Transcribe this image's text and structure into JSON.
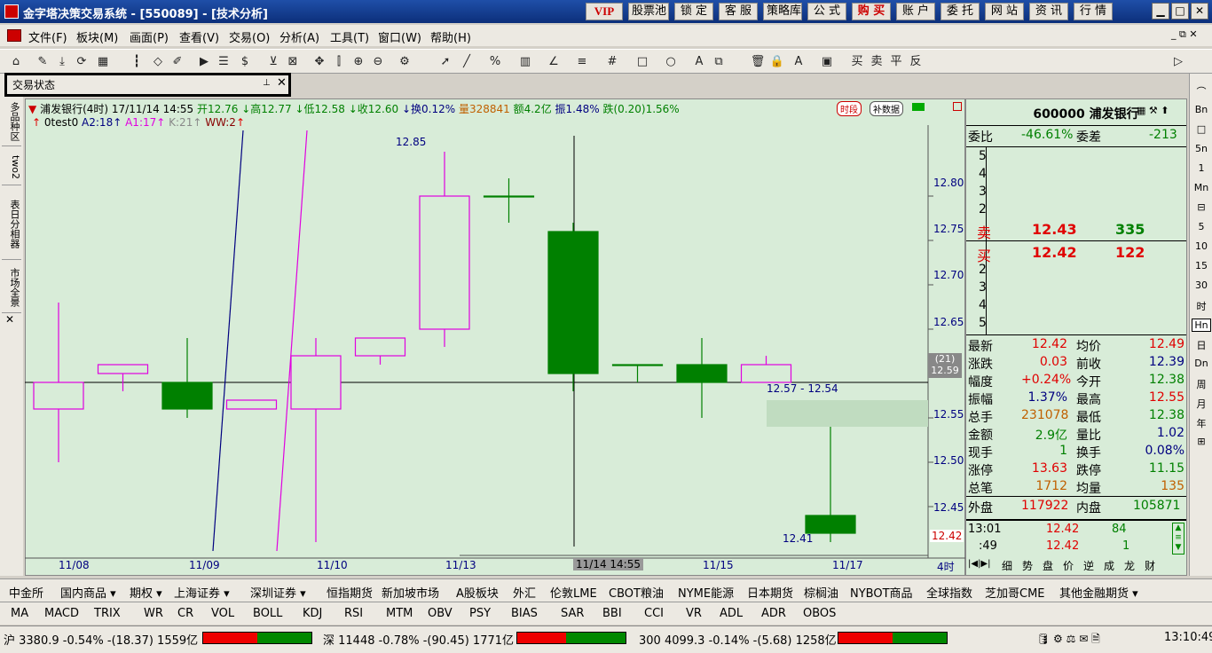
{
  "window": {
    "title": "金字塔决策交易系统 - [550089] - [技术分析]",
    "top_buttons": [
      "VIP",
      "股票池",
      "锁 定",
      "客 服",
      "策略库",
      "公 式",
      "购 买",
      "账 户",
      "委 托",
      "网 站",
      "资 讯",
      "行 情"
    ]
  },
  "menu": [
    "文件(F)",
    "板块(M)",
    "画面(P)",
    "查看(V)",
    "交易(O)",
    "分析(A)",
    "工具(T)",
    "窗口(W)",
    "帮助(H)"
  ],
  "trade_panel": {
    "title": "交易状态",
    "pin": "ᵖ",
    "close": "✕"
  },
  "left_tabs": [
    "多品种区",
    "two2",
    "表日分相器",
    "市场全景"
  ],
  "left_close": "✕",
  "chart": {
    "header": {
      "name": "浦发银行(4时)",
      "datetime": "17/11/14 14:55",
      "open": "开12.76",
      "high": "高12.77",
      "low": "低12.58",
      "close": "收12.60",
      "turnover": "换0.12%",
      "volume": "量328841",
      "amount": "额4.2亿",
      "amplitude": "振1.48%",
      "change": "跌(0.20)1.56%"
    },
    "indicator": {
      "name": "0test0",
      "a2": "A2:18",
      "a1": "A1:17",
      "k": "K:21",
      "ww": "WW:2"
    },
    "badges": [
      "时段",
      "补数据"
    ],
    "price_labels": [
      "12.80",
      "12.75",
      "12.70",
      "12.65",
      "12.55",
      "12.50",
      "12.45"
    ],
    "cursor_price": "(21)\n12.59",
    "cursor_price_a": "(21)",
    "cursor_price_b": "12.59",
    "low_label": "12.42",
    "annot_high": "12.85",
    "annot_low": "12.41",
    "annot_range": "12.57 - 12.54",
    "date_labels": [
      "11/08",
      "11/09",
      "11/10",
      "11/13",
      "11/14 14:55",
      "11/15",
      "11/17"
    ],
    "period": "4时"
  },
  "chart_data": {
    "type": "candlestick",
    "title": "浦发银行(4时)",
    "ylim": [
      12.4,
      12.86
    ],
    "candles": [
      {
        "o": 12.59,
        "h": 12.68,
        "l": 12.5,
        "c": 12.56,
        "color": "magenta"
      },
      {
        "o": 12.6,
        "h": 12.61,
        "l": 12.58,
        "c": 12.61,
        "color": "magenta"
      },
      {
        "o": 12.56,
        "h": 12.64,
        "l": 12.55,
        "c": 12.59,
        "color": "green"
      },
      {
        "o": 12.56,
        "h": 12.57,
        "l": 12.56,
        "c": 12.57,
        "color": "magenta"
      },
      {
        "o": 12.56,
        "h": 12.64,
        "l": 12.41,
        "c": 12.62,
        "color": "magenta"
      },
      {
        "o": 12.62,
        "h": 12.64,
        "l": 12.61,
        "c": 12.64,
        "color": "magenta"
      },
      {
        "o": 12.65,
        "h": 12.85,
        "l": 12.63,
        "c": 12.8,
        "color": "magenta"
      },
      {
        "o": 12.8,
        "h": 12.82,
        "l": 12.77,
        "c": 12.8,
        "color": "green"
      },
      {
        "o": 12.76,
        "h": 12.77,
        "l": 12.58,
        "c": 12.6,
        "color": "green"
      },
      {
        "o": 12.61,
        "h": 12.61,
        "l": 12.59,
        "c": 12.61,
        "color": "green"
      },
      {
        "o": 12.61,
        "h": 12.64,
        "l": 12.55,
        "c": 12.59,
        "color": "green"
      },
      {
        "o": 12.61,
        "h": 12.62,
        "l": 12.59,
        "c": 12.59,
        "color": "magenta"
      },
      {
        "o": 12.44,
        "h": 12.54,
        "l": 12.41,
        "c": 12.42,
        "color": "green"
      }
    ]
  },
  "quote": {
    "code": "600000",
    "name": "浦发银行",
    "weibi_label": "委比",
    "weibi": "-46.61%",
    "weicha_label": "委差",
    "weicha": "-213",
    "sell_levels": [
      "5",
      "4",
      "3",
      "2"
    ],
    "sell_label": "卖",
    "sell_price": "12.43",
    "sell_vol": "335",
    "buy_label": "买",
    "buy_price": "12.42",
    "buy_vol": "122",
    "buy_levels": [
      "2",
      "3",
      "4",
      "5"
    ],
    "stats": [
      {
        "l1": "最新",
        "v1": "12.42",
        "c1": "red",
        "l2": "均价",
        "v2": "12.49",
        "c2": "red"
      },
      {
        "l1": "涨跌",
        "v1": "0.03",
        "c1": "red",
        "l2": "前收",
        "v2": "12.39",
        "c2": "blue"
      },
      {
        "l1": "幅度",
        "v1": "+0.24%",
        "c1": "red",
        "l2": "今开",
        "v2": "12.38",
        "c2": "grn"
      },
      {
        "l1": "振幅",
        "v1": "1.37%",
        "c1": "blue",
        "l2": "最高",
        "v2": "12.55",
        "c2": "red"
      },
      {
        "l1": "总手",
        "v1": "231078",
        "c1": "orange",
        "l2": "最低",
        "v2": "12.38",
        "c2": "grn"
      },
      {
        "l1": "金额",
        "v1": "2.9亿",
        "c1": "grn",
        "l2": "量比",
        "v2": "1.02",
        "c2": "blue"
      },
      {
        "l1": "现手",
        "v1": "1",
        "c1": "grn",
        "l2": "换手",
        "v2": "0.08%",
        "c2": "blue"
      },
      {
        "l1": "涨停",
        "v1": "13.63",
        "c1": "red",
        "l2": "跌停",
        "v2": "11.15",
        "c2": "grn"
      },
      {
        "l1": "总笔",
        "v1": "1712",
        "c1": "orange",
        "l2": "均量",
        "v2": "135",
        "c2": "orange"
      }
    ],
    "outer_label": "外盘",
    "outer": "117922",
    "inner_label": "内盘",
    "inner": "105871",
    "ticks": [
      {
        "t": "13:01",
        "p": "12.42",
        "v": "84"
      },
      {
        "t": ":49",
        "p": "12.42",
        "v": "1"
      }
    ],
    "bottom_tabs": [
      "细",
      "势",
      "盘",
      "价",
      "逆",
      "成",
      "龙",
      "财"
    ]
  },
  "right_tools": [
    "⌒",
    "Bn",
    "□",
    "5n",
    "1",
    "Mn",
    "⊟",
    "5",
    "10",
    "15",
    "30",
    "时",
    "Hn",
    "日",
    "Dn",
    "周",
    "月",
    "年",
    "⊞"
  ],
  "markets": [
    "中金所",
    "国内商品 ▾",
    "期权 ▾",
    "上海证券 ▾",
    "深圳证券 ▾",
    "恒指期货",
    "新加坡市场",
    "A股板块",
    "外汇",
    "伦敦LME",
    "CBOT粮油",
    "NYME能源",
    "日本期货",
    "棕榈油",
    "NYBOT商品",
    "全球指数",
    "芝加哥CME",
    "其他金融期货 ▾"
  ],
  "indicators": [
    "MA",
    "MACD",
    "TRIX",
    "WR",
    "CR",
    "VOL",
    "BOLL",
    "KDJ",
    "RSI",
    "MTM",
    "OBV",
    "PSY",
    "BIAS",
    "SAR",
    "BBI",
    "CCI",
    "VR",
    "ADL",
    "ADR",
    "OBOS"
  ],
  "status": {
    "sh": "沪 3380.9 -0.54% -(18.37) 1559亿",
    "sz": "深 11448 -0.78% -(90.45) 1771亿",
    "hs300": "300 4099.3 -0.14% -(5.68) 1258亿",
    "time": "13:10:49"
  }
}
